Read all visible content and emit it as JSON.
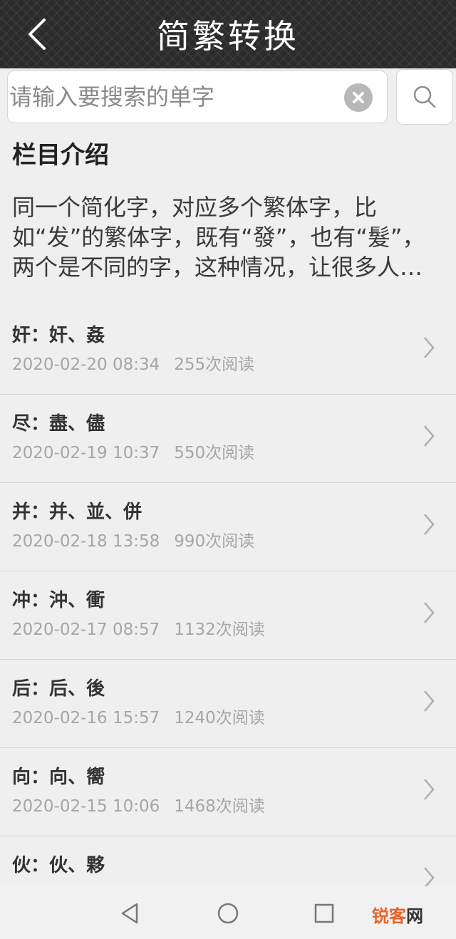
{
  "header": {
    "title": "简繁转换"
  },
  "search": {
    "placeholder": "请输入要搜索的单字",
    "value": ""
  },
  "intro": {
    "title": "栏目介绍",
    "text": "同一个简化字，对应多个繁体字，比如“发”的繁体字，既有“發”，也有“髮”，两个是不同的字，这种情况，让很多人在简繁转换时犯难。"
  },
  "items": [
    {
      "title": "奸：奸、姦",
      "date": "2020-02-20 08:34",
      "reads": "255次阅读"
    },
    {
      "title": "尽：盡、儘",
      "date": "2020-02-19 10:37",
      "reads": "550次阅读"
    },
    {
      "title": "并：并、並、併",
      "date": "2020-02-18 13:58",
      "reads": "990次阅读"
    },
    {
      "title": "冲：沖、衝",
      "date": "2020-02-17 08:57",
      "reads": "1132次阅读"
    },
    {
      "title": "后：后、後",
      "date": "2020-02-16 15:57",
      "reads": "1240次阅读"
    },
    {
      "title": "向：向、嚮",
      "date": "2020-02-15 10:06",
      "reads": "1468次阅读"
    },
    {
      "title": "伙：伙、夥",
      "date": "",
      "reads": ""
    }
  ],
  "watermark": {
    "part1": "锐客",
    "part2": "网"
  },
  "colors": {
    "header_bg": "#2b2b2b",
    "watermark": "#e8632a",
    "meta_text": "#a6a6a6"
  }
}
